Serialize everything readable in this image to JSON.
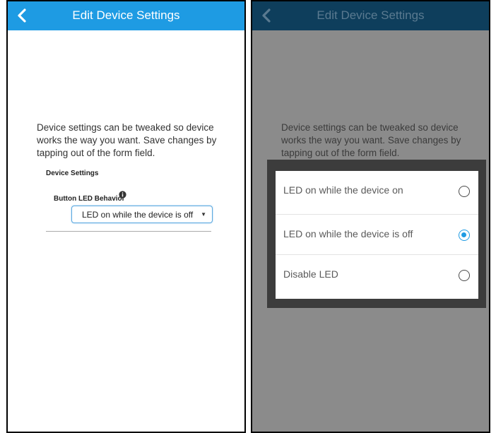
{
  "left": {
    "header": {
      "title": "Edit Device Settings"
    },
    "intro": "Device settings can be tweaked so device works the way you want. Save changes by tapping out of the form field.",
    "section_title": "Device Settings",
    "field_label": "Button LED Behavior",
    "select": {
      "value": "LED on while the device is off"
    }
  },
  "right": {
    "header": {
      "title": "Edit Device Settings"
    },
    "intro": "Device settings can be tweaked so device works the way you want. Save changes by tapping out of the form field.",
    "dialog": {
      "options": [
        {
          "label": "LED on while the device on",
          "selected": false
        },
        {
          "label": "LED on while the device is off",
          "selected": true
        },
        {
          "label": "Disable LED",
          "selected": false
        }
      ]
    }
  },
  "colors": {
    "header_active": "#1e9be3",
    "header_dimmed": "#0e3e5c",
    "overlay": "#8b8b8b",
    "radio_selected": "#1e9be3"
  },
  "icons": [
    "back-chevron-icon",
    "info-icon",
    "dropdown-arrow-icon",
    "radio-icon"
  ]
}
